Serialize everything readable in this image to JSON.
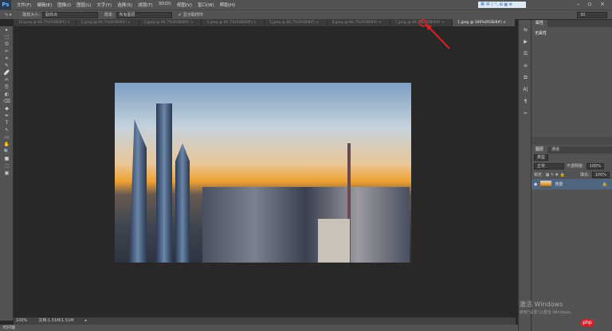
{
  "app": {
    "logo": "Ps"
  },
  "menu": [
    "文件(F)",
    "编辑(E)",
    "图像(I)",
    "图层(L)",
    "文字(Y)",
    "选择(S)",
    "滤镜(T)",
    "3D(D)",
    "视图(V)",
    "窗口(W)",
    "帮助(H)"
  ],
  "ime": "英 中 ♪ °, ⊞ ▦ ⚙",
  "window_controls": [
    "–",
    "▫",
    "×"
  ],
  "options": {
    "size_label": "取样大小:",
    "size_value": "取样点",
    "sample_label": "样本:",
    "sample_value": "所有图层",
    "ring_label": "显示取样环",
    "ring_checked": true,
    "right_value": "30"
  },
  "tabs": [
    "10.jpeg @ 66.7%(RGB/8#)",
    "2.jpeg @ 66.7%(RGB/8#)",
    "3.jpeg @ 66.7%(RGB/8#)",
    "4.jpeg @ 66.7%(RGB/8#)",
    "5.jpeg @ 66.7%(RGB/8#)",
    "6.jpeg @ 66.7%(RGB/8#)",
    "7.jpeg @ 66.7%(RGB/8#)",
    "1.jpeg @ 100%(RGB/8#)"
  ],
  "active_tab": 7,
  "properties": {
    "tab": "属性",
    "text": "无属性"
  },
  "layers": {
    "tabs": [
      "图层",
      "通道"
    ],
    "filter": "类型",
    "blend": "正常",
    "opacity_label": "不透明度:",
    "opacity": "100%",
    "lock_label": "锁定:",
    "fill_label": "填充:",
    "fill": "100%",
    "items": [
      {
        "name": "背景"
      }
    ]
  },
  "status": {
    "zoom": "100%",
    "doc": "文档:1.51M/1.51M"
  },
  "timeline": "时间轴",
  "watermark": {
    "title": "激活 Windows",
    "subtitle": "转到\"设置\"以激活 Windows。"
  },
  "badge": "php",
  "colors": {
    "panel": "#535353",
    "canvas": "#282828",
    "selected_layer": "#4f6580",
    "arrow": "#e02020"
  }
}
